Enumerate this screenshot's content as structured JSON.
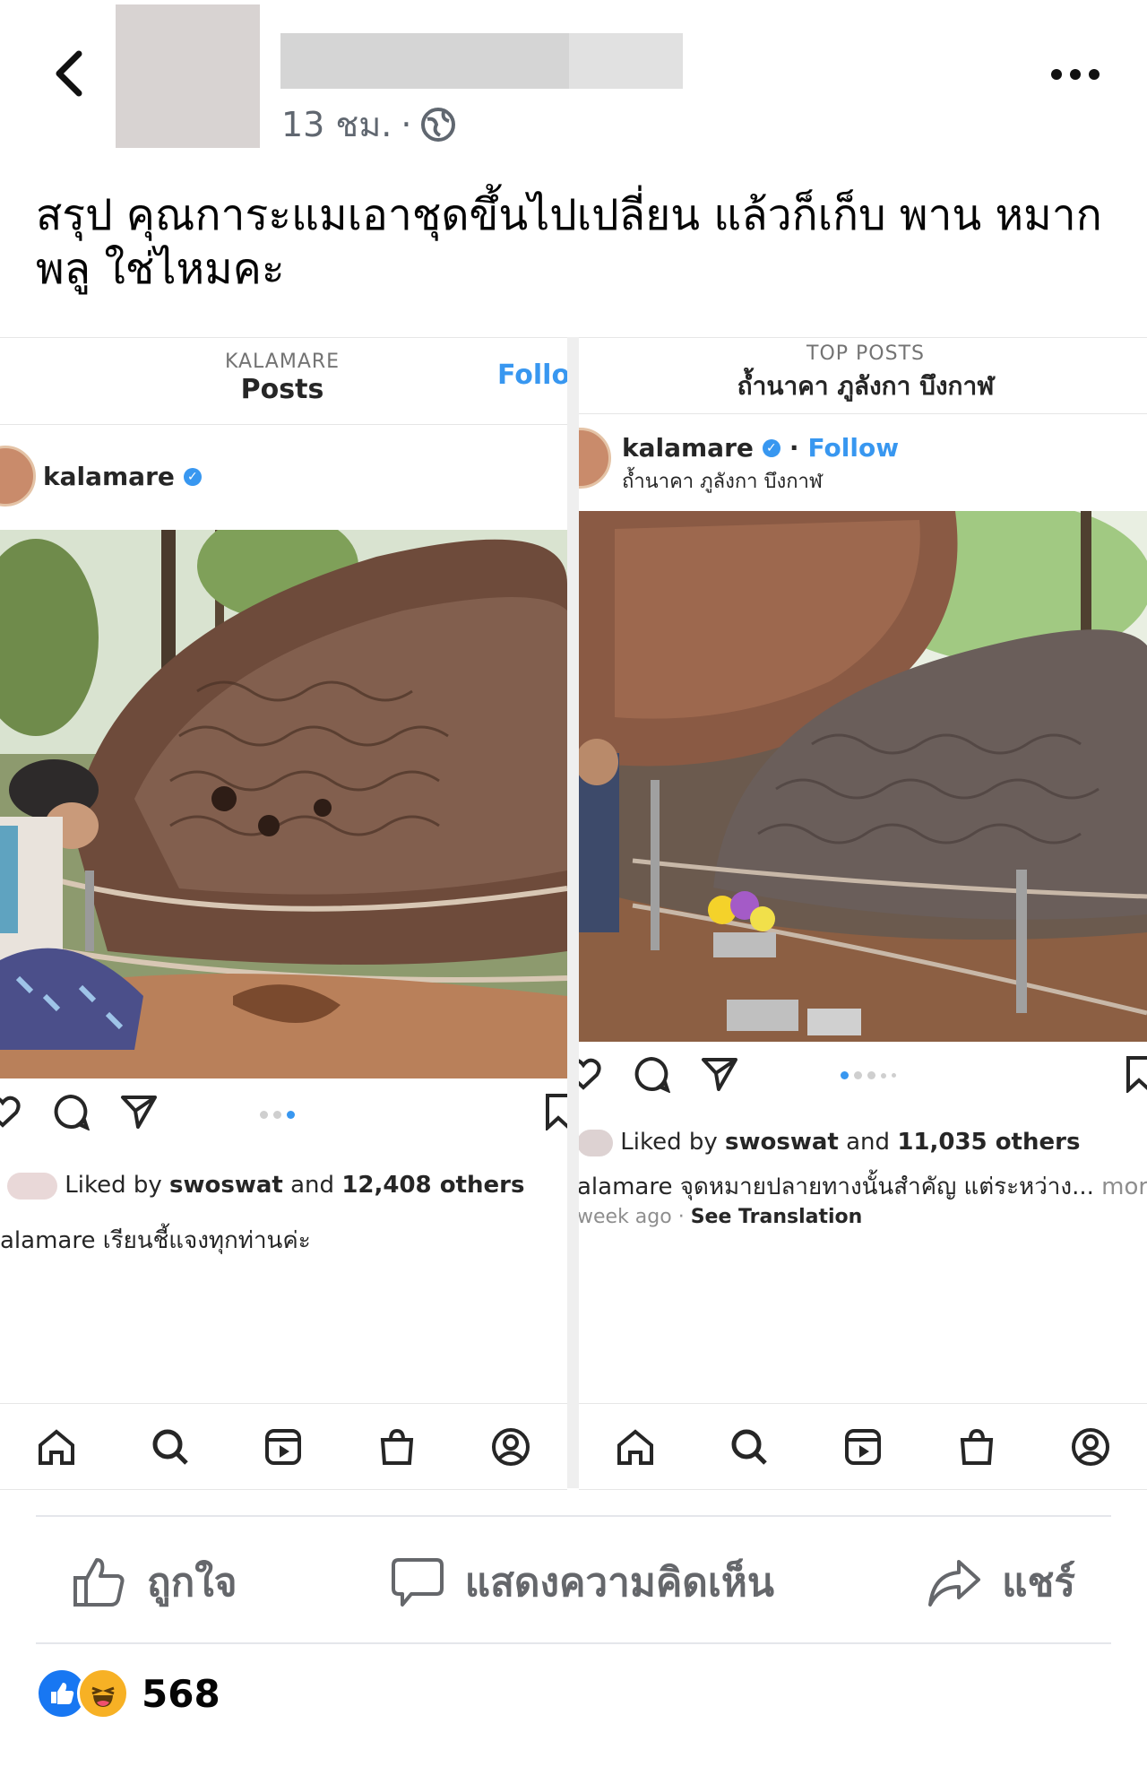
{
  "header": {
    "timestamp": "13 ชม.",
    "privacy_icon": "globe-icon"
  },
  "post": {
    "caption": "สรุป คุณการะแมเอาชุดขึ้นไปเปลี่ยน แล้วก็เก็บ พาน หมากพลู ใช่ไหมคะ"
  },
  "left_screenshot": {
    "top_label": "KALAMARE",
    "title": "Posts",
    "follow": "Follo",
    "username": "kalamare",
    "liked_prefix": "Liked by ",
    "liked_user": "swoswat",
    "liked_mid": " and ",
    "liked_count": "12,408 others",
    "caption": "alamare เรียนชี้แจงทุกท่านค่ะ"
  },
  "right_screenshot": {
    "top_label": "TOP POSTS",
    "title": "ถ้ำนาคา ภูลังกา บึงกาฬ",
    "username": "kalamare",
    "dot_sep": "·",
    "follow": "Follow",
    "location": "ถ้ำนาคา ภูลังกา บึงกาฬ",
    "liked_prefix": "Liked by ",
    "liked_user": "swoswat",
    "liked_mid": " and ",
    "liked_count": "11,035 others",
    "caption": "alamare จุดหมายปลายทางนั้นสำคัญ แต่ระหว่าง...",
    "more": " more",
    "time": "week ago",
    "time_sep": " · ",
    "see_translation": "See Translation"
  },
  "actions": {
    "like": "ถูกใจ",
    "comment": "แสดงความคิดเห็น",
    "share": "แชร์"
  },
  "reactions": {
    "count": "568",
    "icons": [
      "like-reaction",
      "haha-reaction"
    ]
  },
  "colors": {
    "instagram_blue": "#3897f0",
    "facebook_blue": "#1877f2",
    "meta_gray": "#606770"
  }
}
